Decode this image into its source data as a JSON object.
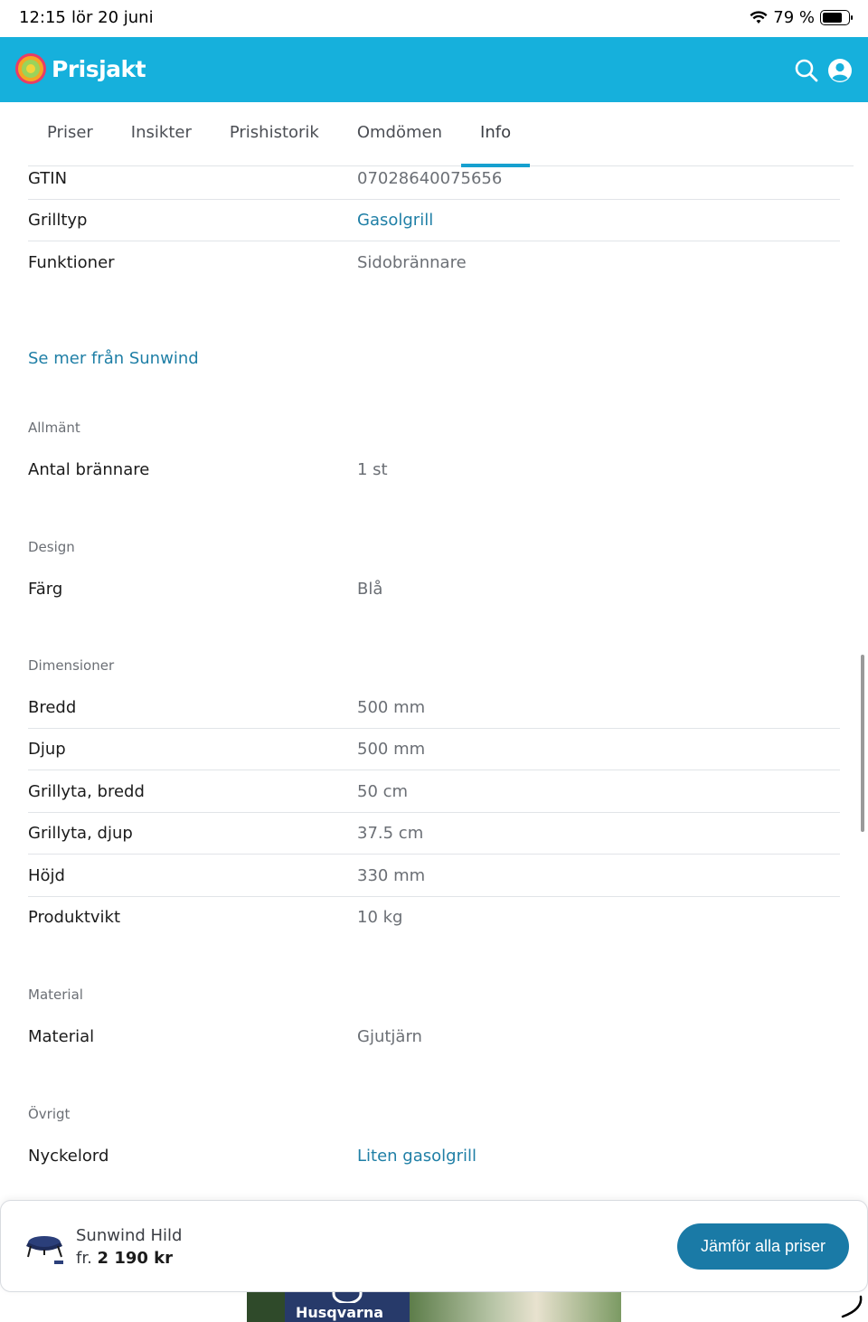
{
  "status_bar": {
    "time": "12:15",
    "date": "lör 20 juni",
    "battery": "79 %",
    "battery_level": 0.79
  },
  "header": {
    "brand": "Prisjakt",
    "search_icon": "search-icon",
    "account_icon": "user-icon",
    "color": "#16b0dc"
  },
  "tabs": [
    {
      "label": "Priser",
      "active": false
    },
    {
      "label": "Insikter",
      "active": false
    },
    {
      "label": "Prishistorik",
      "active": false
    },
    {
      "label": "Omdömen",
      "active": false
    },
    {
      "label": "Info",
      "active": true
    }
  ],
  "top_specs": [
    {
      "key": "GTIN",
      "value": "07028640075656"
    },
    {
      "key": "Grilltyp",
      "value": "Gasolgrill"
    },
    {
      "key": "Funktioner",
      "value": "Sidobrännare"
    }
  ],
  "see_more": "Se mer från Sunwind",
  "sections": {
    "allmant": {
      "title": "Allmänt",
      "rows": [
        {
          "key": "Antal brännare",
          "value": "1 st"
        }
      ]
    },
    "design": {
      "title": "Design",
      "rows": [
        {
          "key": "Färg",
          "value": "Blå"
        }
      ]
    },
    "dimensioner": {
      "title": "Dimensioner",
      "rows": [
        {
          "key": "Bredd",
          "value": "500 mm"
        },
        {
          "key": "Djup",
          "value": "500 mm"
        },
        {
          "key": "Grillyta, bredd",
          "value": "50 cm"
        },
        {
          "key": "Grillyta, djup",
          "value": "37.5 cm"
        },
        {
          "key": "Höjd",
          "value": "330 mm"
        },
        {
          "key": "Produktvikt",
          "value": "10 kg"
        }
      ]
    },
    "material": {
      "title": "Material",
      "rows": [
        {
          "key": "Material",
          "value": "Gjutjärn"
        }
      ]
    },
    "ovrigt": {
      "title": "Övrigt",
      "rows": [
        {
          "key": "Nyckelord",
          "value": "Liten gasolgrill"
        }
      ]
    }
  },
  "bottom_bar": {
    "product_name": "Sunwind Hild",
    "price_prefix": "fr.",
    "price": "2 190 kr",
    "cta": "Jämför alla priser",
    "cta_color": "#1a7aa6"
  },
  "ad": {
    "brand": "Husqvarna"
  }
}
